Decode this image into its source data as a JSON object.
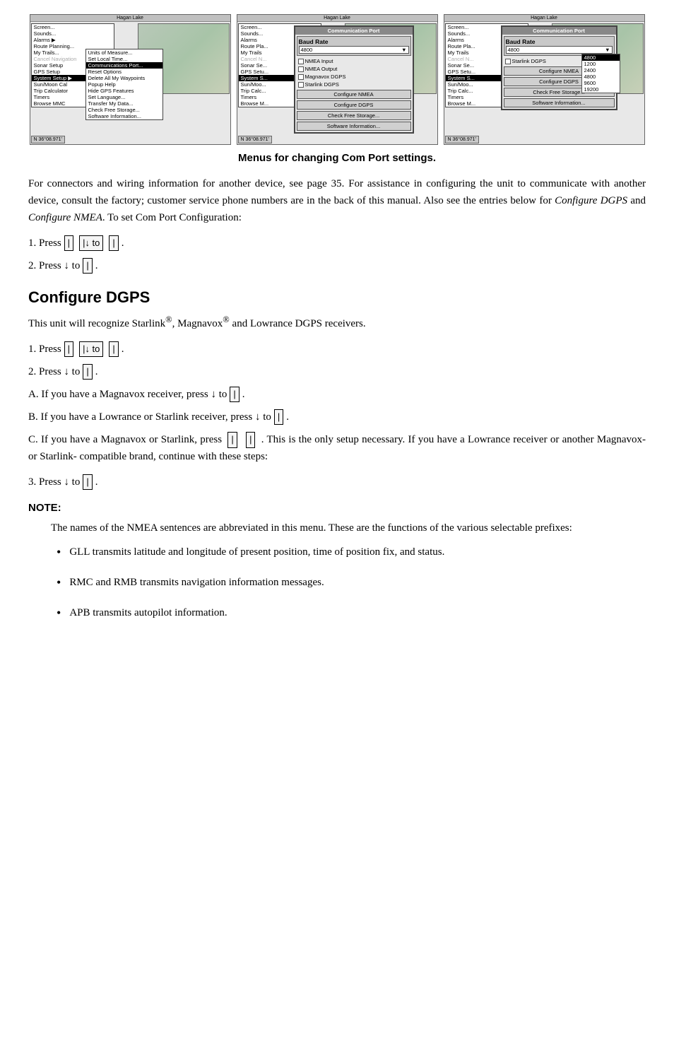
{
  "screenshots": {
    "caption": "Menus for changing Com Port settings.",
    "screen1": {
      "title": "Hagan Lake",
      "menu_items": [
        "Screen...",
        "Sounds...",
        "Alarms",
        "Route Planning...",
        "My Trails...",
        "Cancel Navigation",
        "Sonar Setup",
        "GPS Setup",
        "System Setup",
        "Sun/Moon Cal",
        "Trip Calculator",
        "Timers",
        "Browse MMC"
      ],
      "submenu": [
        "Units of Measure...",
        "Set Local Time...",
        "Communications Port...",
        "Reset Options",
        "Delete All My Waypoints",
        "Popup Help",
        "Hide GPS Features",
        "Set Language...",
        "Transfer My Data...",
        "Check Free Storage...",
        "Software Information..."
      ],
      "coords": "N 36°08.971'"
    },
    "screen2": {
      "title": "Hagan Lake",
      "comm_title": "Communication Port",
      "baud_label": "Baud Rate",
      "baud_value": "4800",
      "checkboxes": [
        "NMEA Input",
        "NMEA Output",
        "Magnavox DGPS",
        "Starlink DGPS"
      ],
      "buttons": [
        "Configure NMEA",
        "Configure DGPS",
        "Check Free Storage...",
        "Software Information..."
      ],
      "coords": "N 36°08.971'"
    },
    "screen3": {
      "title": "Hagan Lake",
      "comm_title": "Communication Port",
      "baud_label": "Baud Rate",
      "baud_values": [
        "4800",
        "1200",
        "2400",
        "4800",
        "9600",
        "19200"
      ],
      "baud_selected": "4800",
      "checkboxes": [
        "Starlink DGPS"
      ],
      "buttons": [
        "Configure NMEA",
        "Configure DGPS",
        "Check Free Storage...",
        "Software Information..."
      ],
      "coords": "N 36°08.971'"
    }
  },
  "intro_paragraph": "For connectors and wiring information for another device, see page 35. For assistance in configuring the unit to communicate with another device, consult the factory; customer service phone numbers are in the back of this manual. Also see the entries below for Configure DGPS and Configure NMEA. To set Com Port Configuration:",
  "steps_comport": [
    {
      "number": "1.",
      "text": "Press",
      "key1": "|",
      "key2": "|↓ to",
      "key3": "|",
      "end": "."
    },
    {
      "number": "2.",
      "text": "Press ↓ to",
      "key1": "|",
      "end": "."
    }
  ],
  "configure_dgps": {
    "title": "Configure DGPS",
    "intro": "This unit will recognize Starlink®, Magnavox® and Lowrance DGPS receivers.",
    "steps": [
      {
        "number": "1.",
        "text": "Press",
        "key1": "|",
        "key2": "|↓ to",
        "key3": "|",
        "end": "."
      },
      {
        "number": "2.",
        "text": "Press ↓ to",
        "key1": "|",
        "end": "."
      },
      {
        "number": "A.",
        "text": "If you have a Magnavox receiver, press ↓ to",
        "key1": "|",
        "end": "."
      },
      {
        "number": "B.",
        "text": "If you have a Lowrance or Starlink receiver, press ↓ to",
        "key1": "|",
        "end": "."
      },
      {
        "number": "C.",
        "text": "If you have a Magnavox or Starlink, press",
        "key1": "|",
        "key2": "|",
        "end": ". This is the only setup necessary. If you have a Lowrance receiver or another Magnavox- or Starlink- compatible brand, continue with these steps:"
      },
      {
        "number": "3.",
        "text": "Press ↓ to",
        "key1": "|",
        "end": "."
      }
    ]
  },
  "note": {
    "label": "NOTE:",
    "text": "The names of the NMEA sentences are abbreviated in this menu. These are the functions of the various selectable prefixes:",
    "bullets": [
      "GLL transmits latitude and longitude of present position, time of position fix, and status.",
      "RMC and RMB transmits navigation information messages.",
      "APB transmits autopilot information."
    ]
  }
}
